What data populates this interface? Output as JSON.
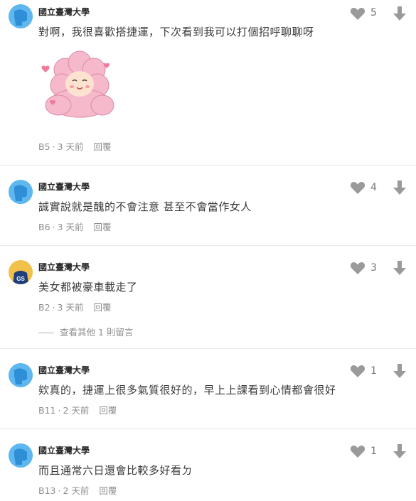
{
  "comments": [
    {
      "school": "國立臺灣大學",
      "text": "對啊，我很喜歡搭捷運，下次看到我可以打個招呼聊聊呀",
      "floor": "B5",
      "time": "3 天前",
      "reply": "回覆",
      "likes": "5",
      "has_sticker": true
    },
    {
      "school": "國立臺灣大學",
      "text": "誠實說就是醜的不會注意 甚至不會當作女人",
      "floor": "B6",
      "time": "3 天前",
      "reply": "回覆",
      "likes": "4"
    },
    {
      "school": "國立臺灣大學",
      "text": "美女都被豪車載走了",
      "floor": "B2",
      "time": "3 天前",
      "reply": "回覆",
      "likes": "3",
      "avatar": "GS",
      "more_replies": "查看其他 1 則留言"
    },
    {
      "school": "國立臺灣大學",
      "text": "欸真的，捷運上很多氣質很好的，早上上課看到心情都會很好",
      "floor": "B11",
      "time": "2 天前",
      "reply": "回覆",
      "likes": "1"
    },
    {
      "school": "國立臺灣大學",
      "text": "而且通常六日還會比較多好看ㄉ",
      "floor": "B13",
      "time": "2 天前",
      "reply": "回覆",
      "likes": "1"
    }
  ],
  "colors": {
    "avatar_blue": "#5fb7ef",
    "avatar_gs_bg": "#f2c14a",
    "avatar_gs_shirt": "#1d3f7a",
    "icon_grey": "#9a9a9a",
    "sticker_pink": "#f6b9cc"
  },
  "icons": [
    "heart-icon",
    "arrow-down-icon",
    "sticker-image"
  ]
}
